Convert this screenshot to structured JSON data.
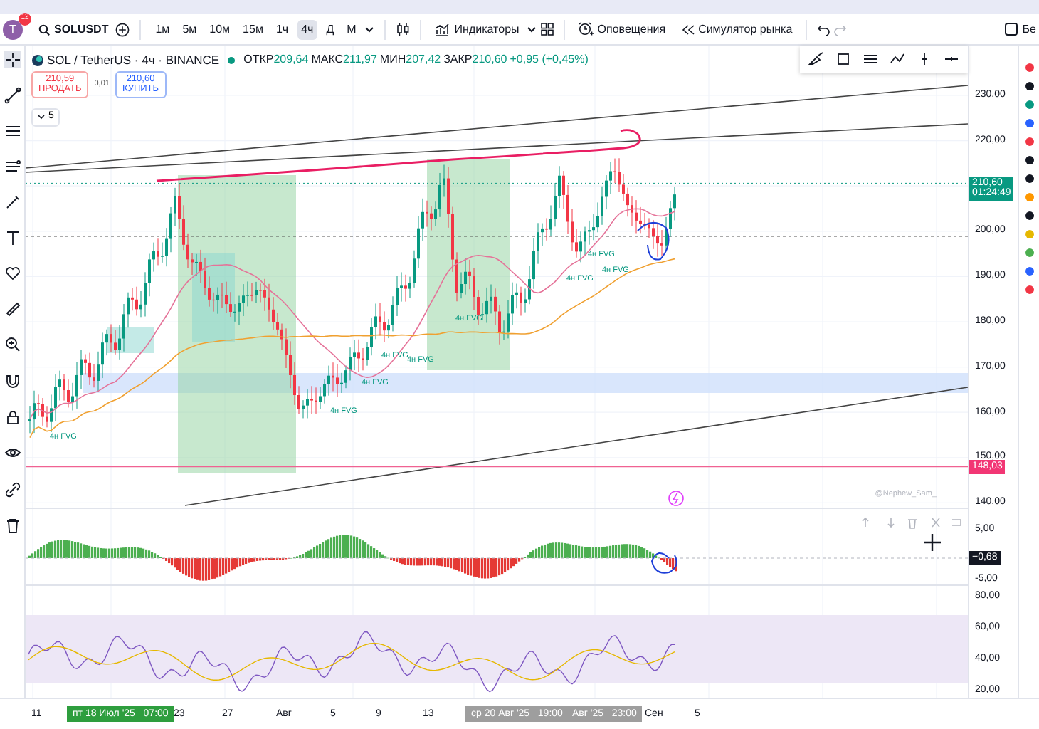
{
  "toolbar": {
    "avatar_letter": "T",
    "notification_count": "12",
    "symbol": "SOLUSDT",
    "intervals": [
      {
        "label": "1м",
        "selected": false
      },
      {
        "label": "5м",
        "selected": false
      },
      {
        "label": "10м",
        "selected": false
      },
      {
        "label": "15м",
        "selected": false
      },
      {
        "label": "1ч",
        "selected": false
      },
      {
        "label": "4ч",
        "selected": true
      },
      {
        "label": "Д",
        "selected": false
      },
      {
        "label": "М",
        "selected": false
      }
    ],
    "indicators": "Индикаторы",
    "alerts": "Оповещения",
    "replay": "Симулятор рынка",
    "checkbox_checked": false,
    "right_label": "Бе"
  },
  "legend": {
    "title": "SOL / TetherUS · 4ч · BINANCE",
    "fields": [
      {
        "label": "ОТКР",
        "value": "209,64"
      },
      {
        "label": "МАКС",
        "value": "211,97"
      },
      {
        "label": "МИН",
        "value": "207,42"
      },
      {
        "label": "ЗАКР",
        "value": "210,60"
      }
    ],
    "change": "+0,95 (+0,45%)"
  },
  "trade": {
    "sell_price": "210,59",
    "sell_label": "ПРОДАТЬ",
    "spread": "0,01",
    "buy_price": "210,60",
    "buy_label": "КУПИТЬ"
  },
  "indicator_count": "5",
  "fvg_labels": [
    "4н FVG",
    "4н FVG",
    "4н FVG",
    "4н FVG",
    "4н FVG",
    "4н FVG",
    "4н FVG",
    "4н FVG",
    "4н FVG"
  ],
  "signature": "@Nephew_Sam_",
  "price_axis": {
    "ticks": [
      "230,00",
      "220,00",
      "200,00",
      "190,00",
      "180,00",
      "170,00",
      "160,00",
      "150,00",
      "140,00"
    ],
    "last_price": "210,60",
    "countdown": "01:24:49",
    "level": "148,03"
  },
  "oscillator_axis": {
    "ticks": [
      "5,00",
      "-5,00"
    ],
    "value": "−0,68"
  },
  "rsi_axis": {
    "ticks": [
      "80,00",
      "60,00",
      "40,00",
      "20,00"
    ]
  },
  "time_axis": {
    "labels": [
      "11",
      "23",
      "27",
      "Авг",
      "5",
      "9",
      "13",
      "Сен",
      "5"
    ],
    "crosshair_labels": [
      "пт 18 Июл '25   07:00",
      "ср 20 Авг '25   19:00",
      "Авг '25   23:00"
    ]
  }
}
